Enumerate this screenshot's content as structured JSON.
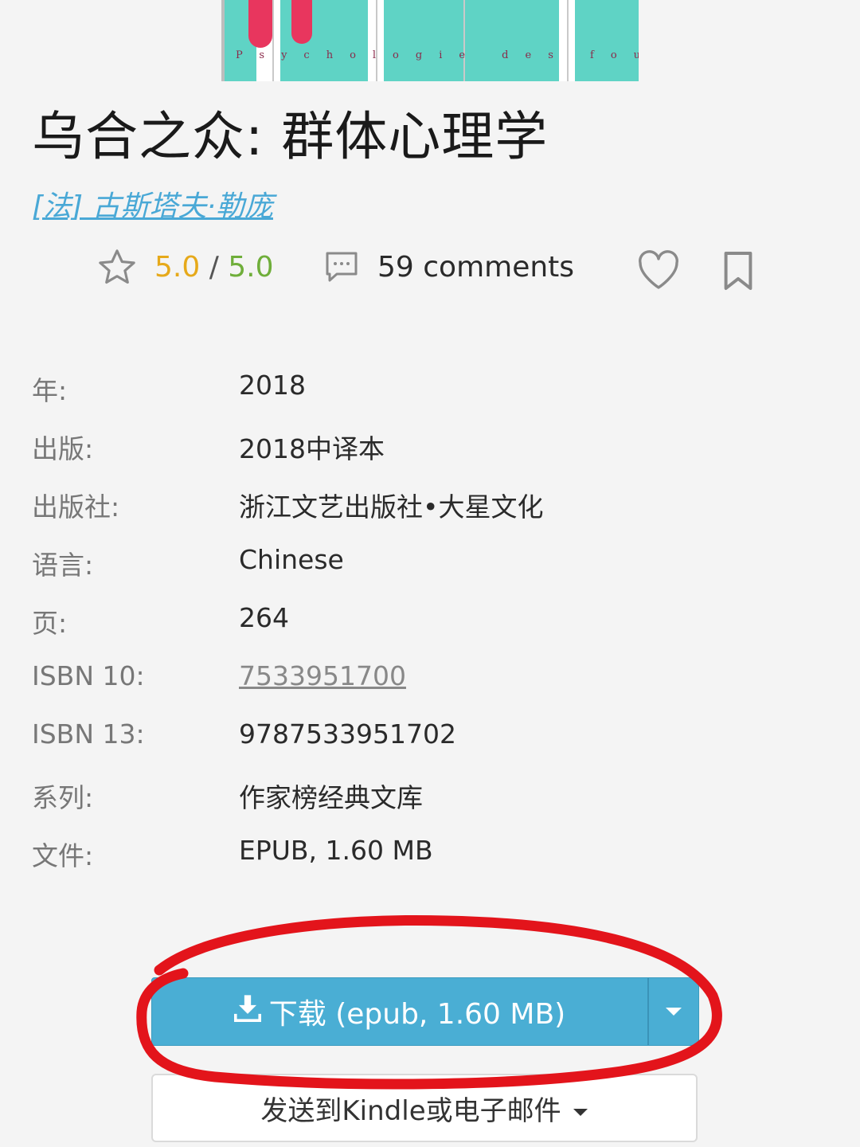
{
  "cover": {
    "subtitle": "Psychologie des foules"
  },
  "book": {
    "title": "乌合之众: 群体心理学",
    "author": "[法] 古斯塔夫·勒庞"
  },
  "stats": {
    "rating": "5.0",
    "rating_sep": " / ",
    "rating_max": "5.0",
    "comments": "59 comments",
    "icons": [
      "star-icon",
      "comment-icon",
      "heart-icon",
      "bookmark-icon"
    ],
    "colors": {
      "rating": "#e6a91a",
      "rating_max": "#6fae3a",
      "author_link": "#49a8d6"
    }
  },
  "details": [
    {
      "label": "年:",
      "value": "2018"
    },
    {
      "label": "出版:",
      "value": "2018中译本"
    },
    {
      "label": "出版社:",
      "value": "浙江文艺出版社•大星文化"
    },
    {
      "label": "语言:",
      "value": "Chinese"
    },
    {
      "label": "页:",
      "value": "264"
    },
    {
      "label": "ISBN 10:",
      "value": "7533951700"
    },
    {
      "label": "ISBN 13:",
      "value": "9787533951702"
    },
    {
      "label": "系列:",
      "value": "作家榜经典文库"
    },
    {
      "label": "文件:",
      "value": "EPUB, 1.60 MB"
    }
  ],
  "download": {
    "label": "下载 (epub, 1.60 MB)",
    "icons": [
      "download-icon",
      "caret-down-icon"
    ],
    "color": "#4aaed4"
  },
  "send": {
    "label": "发送到Kindle或电子邮件"
  },
  "annotation": {
    "color": "#e3141b"
  }
}
